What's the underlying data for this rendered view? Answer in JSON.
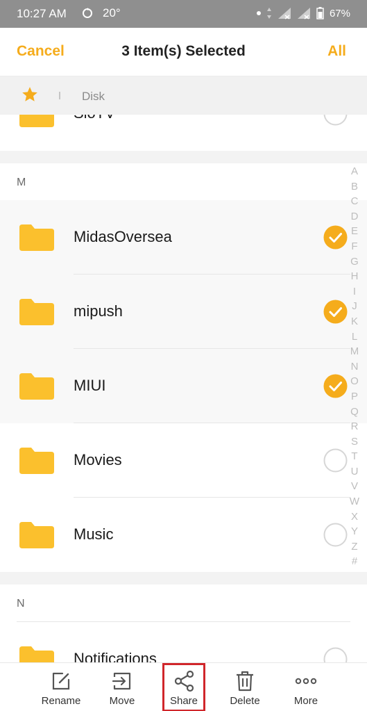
{
  "status_bar": {
    "time": "10:27 AM",
    "temperature": "20°",
    "battery": "67%"
  },
  "header": {
    "cancel_label": "Cancel",
    "title": "3 Item(s) Selected",
    "all_label": "All"
  },
  "breadcrumb": {
    "location": "Disk"
  },
  "sections": [
    {
      "letter": "M"
    },
    {
      "letter": "N"
    }
  ],
  "folders": [
    {
      "name": "SloTV",
      "selected": false
    },
    {
      "name": "MidasOversea",
      "selected": true
    },
    {
      "name": "mipush",
      "selected": true
    },
    {
      "name": "MIUI",
      "selected": true
    },
    {
      "name": "Movies",
      "selected": false
    },
    {
      "name": "Music",
      "selected": false
    },
    {
      "name": "Notifications",
      "selected": false
    }
  ],
  "alphabet_index": [
    "A",
    "B",
    "C",
    "D",
    "E",
    "F",
    "G",
    "H",
    "I",
    "J",
    "K",
    "L",
    "M",
    "N",
    "O",
    "P",
    "Q",
    "R",
    "S",
    "T",
    "U",
    "V",
    "W",
    "X",
    "Y",
    "Z",
    "#"
  ],
  "toolbar": {
    "rename_label": "Rename",
    "move_label": "Move",
    "share_label": "Share",
    "delete_label": "Delete",
    "more_label": "More"
  },
  "colors": {
    "accent": "#f5ac1c",
    "folder": "#fbc02d",
    "status_bar": "#8f8f8f",
    "highlight_box": "#d0262b"
  }
}
